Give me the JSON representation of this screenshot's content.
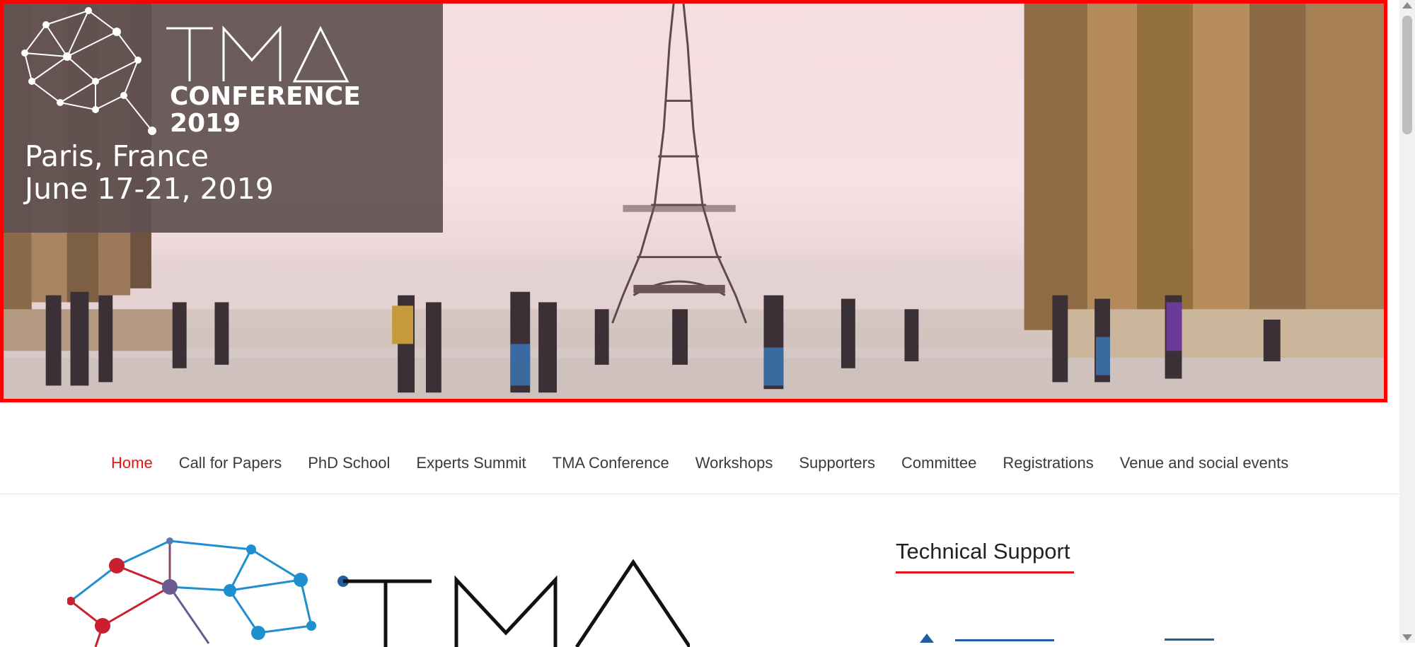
{
  "hero": {
    "logo_word": "TMA",
    "conference_label": "CONFERENCE",
    "year": "2019",
    "location": "Paris, France",
    "dates": "June 17-21, 2019"
  },
  "nav": {
    "items": [
      {
        "label": "Home",
        "active": true
      },
      {
        "label": "Call for Papers",
        "active": false
      },
      {
        "label": "PhD School",
        "active": false
      },
      {
        "label": "Experts Summit",
        "active": false
      },
      {
        "label": "TMA Conference",
        "active": false
      },
      {
        "label": "Workshops",
        "active": false
      },
      {
        "label": "Supporters",
        "active": false
      },
      {
        "label": "Committee",
        "active": false
      },
      {
        "label": "Registrations",
        "active": false
      },
      {
        "label": "Venue and social events",
        "active": false
      }
    ]
  },
  "main": {
    "logo_word": "TMA"
  },
  "sidebar": {
    "title": "Technical Support"
  },
  "colors": {
    "accent": "#e7131a",
    "frame": "#ff0000",
    "nav_text": "#3a3a3a",
    "logo_red": "#c8202e",
    "logo_blue": "#1f8fd0",
    "logo_purple": "#6b5a8e"
  }
}
